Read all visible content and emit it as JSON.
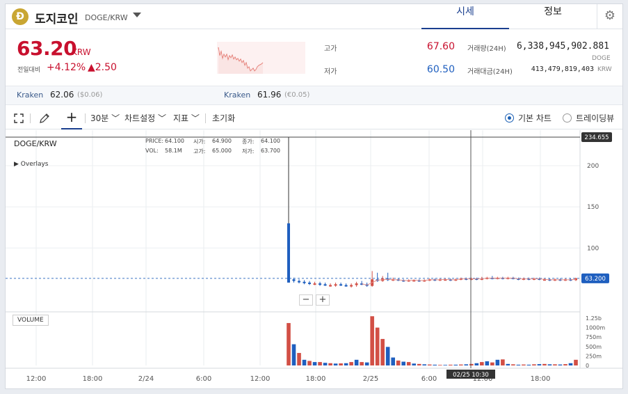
{
  "header": {
    "coin_logo_glyph": "Ð",
    "coin_name": "도지코인",
    "pair": "DOGE/KRW",
    "tabs": [
      {
        "label": "시세"
      },
      {
        "label": "정보"
      }
    ],
    "settings_icon": "gear-icon"
  },
  "price": {
    "current": "63.20",
    "unit": "KRW",
    "change_label": "전일대비",
    "change_pct": "+4.12%",
    "change_amt": "▲2.50"
  },
  "stats": {
    "high_label": "고가",
    "high_value": "67.60",
    "low_label": "저가",
    "low_value": "60.50",
    "volume_label": "거래량(24H)",
    "volume_value": "6,338,945,902.881",
    "volume_unit": "DOGE",
    "turnover_label": "거래대금(24H)",
    "turnover_value": "413,479,819,403",
    "turnover_unit": "KRW"
  },
  "exchanges": [
    {
      "name": "Kraken",
      "value": "62.06",
      "sub": "($0.06)"
    },
    {
      "name": "Kraken",
      "value": "61.96",
      "sub": "(€0.05)"
    }
  ],
  "toolbar": {
    "interval": "30분",
    "chart_settings": "차트설정",
    "indicators": "지표",
    "reset": "초기화",
    "basic_chart": "기본 차트",
    "tradingview": "트레이딩뷰"
  },
  "chart": {
    "symbol": "DOGE/KRW",
    "overlays": "Overlays",
    "ohlc": {
      "price_lbl": "PRICE:",
      "price": "64.100",
      "open_lbl": "시가:",
      "open": "64.900",
      "close_lbl": "종가:",
      "close": "64.100",
      "vol_lbl": "VOL:",
      "vol": "58.1M",
      "high_lbl": "고가:",
      "high": "65.000",
      "low_lbl": "저가:",
      "low": "63.700"
    },
    "max_label": "234.655",
    "current_label": "63.200",
    "volume_label": "VOLUME",
    "crosshair_time": "02/25 10:30",
    "price_ticks": [
      "200",
      "150",
      "100"
    ],
    "volume_ticks": [
      "1.25b",
      "1000m",
      "750m",
      "500m",
      "250m",
      "0"
    ],
    "time_ticks": [
      "12:00",
      "18:00",
      "2/24",
      "6:00",
      "12:00",
      "18:00",
      "2/25",
      "6:00",
      "12:00",
      "18:00"
    ],
    "colors": {
      "up": "#d24f45",
      "down": "#1f5fbf"
    }
  },
  "chart_data": {
    "type": "candlestick",
    "price_axis": [
      0,
      234.655
    ],
    "candles": [
      {
        "o": 58,
        "c": 130,
        "h": 234.655,
        "l": 58
      },
      {
        "o": 62,
        "c": 60,
        "h": 64,
        "l": 58
      },
      {
        "o": 60,
        "c": 59,
        "h": 62,
        "l": 57
      },
      {
        "o": 59,
        "c": 58,
        "h": 61,
        "l": 56
      },
      {
        "o": 58,
        "c": 57,
        "h": 60,
        "l": 55
      },
      {
        "o": 57,
        "c": 57,
        "h": 59,
        "l": 55
      },
      {
        "o": 57,
        "c": 56,
        "h": 59,
        "l": 54
      },
      {
        "o": 56,
        "c": 55,
        "h": 58,
        "l": 54
      },
      {
        "o": 55,
        "c": 55,
        "h": 57,
        "l": 53
      },
      {
        "o": 55,
        "c": 56,
        "h": 58,
        "l": 53
      },
      {
        "o": 56,
        "c": 55,
        "h": 58,
        "l": 54
      },
      {
        "o": 55,
        "c": 54,
        "h": 57,
        "l": 53
      },
      {
        "o": 54,
        "c": 55,
        "h": 57,
        "l": 52
      },
      {
        "o": 55,
        "c": 57,
        "h": 59,
        "l": 53
      },
      {
        "o": 57,
        "c": 56,
        "h": 60,
        "l": 55
      },
      {
        "o": 56,
        "c": 54,
        "h": 58,
        "l": 53
      },
      {
        "o": 54,
        "c": 62,
        "h": 72,
        "l": 53
      },
      {
        "o": 62,
        "c": 60,
        "h": 70,
        "l": 59
      },
      {
        "o": 60,
        "c": 63,
        "h": 66,
        "l": 59
      },
      {
        "o": 63,
        "c": 61,
        "h": 70,
        "l": 60
      },
      {
        "o": 61,
        "c": 62,
        "h": 64,
        "l": 60
      },
      {
        "o": 62,
        "c": 61,
        "h": 63,
        "l": 60
      },
      {
        "o": 61,
        "c": 60,
        "h": 62,
        "l": 59
      },
      {
        "o": 60,
        "c": 61,
        "h": 62,
        "l": 59
      },
      {
        "o": 61,
        "c": 61,
        "h": 62,
        "l": 60
      },
      {
        "o": 61,
        "c": 60,
        "h": 62,
        "l": 59
      },
      {
        "o": 60,
        "c": 61,
        "h": 62,
        "l": 59
      },
      {
        "o": 61,
        "c": 62,
        "h": 63,
        "l": 60
      },
      {
        "o": 62,
        "c": 61,
        "h": 63,
        "l": 60
      },
      {
        "o": 61,
        "c": 62,
        "h": 63,
        "l": 60
      },
      {
        "o": 62,
        "c": 62,
        "h": 63,
        "l": 61
      },
      {
        "o": 62,
        "c": 61,
        "h": 63,
        "l": 60
      },
      {
        "o": 61,
        "c": 62,
        "h": 63,
        "l": 60
      },
      {
        "o": 62,
        "c": 63,
        "h": 64,
        "l": 61
      },
      {
        "o": 63,
        "c": 62,
        "h": 64,
        "l": 61
      },
      {
        "o": 62,
        "c": 63,
        "h": 64,
        "l": 61
      },
      {
        "o": 63,
        "c": 62,
        "h": 64,
        "l": 61
      },
      {
        "o": 62,
        "c": 63,
        "h": 65,
        "l": 61
      },
      {
        "o": 63,
        "c": 64,
        "h": 65,
        "l": 62
      },
      {
        "o": 64,
        "c": 63,
        "h": 66,
        "l": 62
      },
      {
        "o": 63,
        "c": 64,
        "h": 65,
        "l": 62
      },
      {
        "o": 64,
        "c": 63,
        "h": 65,
        "l": 62
      },
      {
        "o": 63,
        "c": 64,
        "h": 65,
        "l": 62
      },
      {
        "o": 64,
        "c": 63,
        "h": 65,
        "l": 62
      },
      {
        "o": 63,
        "c": 62,
        "h": 64,
        "l": 61
      },
      {
        "o": 62,
        "c": 63,
        "h": 64,
        "l": 61
      },
      {
        "o": 63,
        "c": 62,
        "h": 64,
        "l": 61
      },
      {
        "o": 62,
        "c": 63,
        "h": 64,
        "l": 61
      },
      {
        "o": 63,
        "c": 62,
        "h": 64,
        "l": 61
      },
      {
        "o": 62,
        "c": 62,
        "h": 63,
        "l": 61
      },
      {
        "o": 62,
        "c": 61,
        "h": 63,
        "l": 60
      },
      {
        "o": 61,
        "c": 62,
        "h": 63,
        "l": 60
      },
      {
        "o": 62,
        "c": 61,
        "h": 63,
        "l": 60
      },
      {
        "o": 61,
        "c": 62,
        "h": 63,
        "l": 60
      },
      {
        "o": 62,
        "c": 61,
        "h": 63,
        "l": 60
      },
      {
        "o": 61,
        "c": 63.2,
        "h": 64,
        "l": 60
      }
    ],
    "volume_axis": [
      0,
      1250
    ],
    "volumes": [
      1120,
      560,
      330,
      150,
      120,
      90,
      90,
      70,
      60,
      50,
      55,
      60,
      90,
      150,
      90,
      80,
      1300,
      1000,
      700,
      490,
      210,
      130,
      100,
      90,
      50,
      40,
      30,
      25,
      20,
      15,
      15,
      20,
      20,
      25,
      30,
      40,
      60,
      90,
      110,
      80,
      150,
      160,
      40,
      30,
      20,
      25,
      20,
      30,
      35,
      40,
      30,
      30,
      25,
      35,
      60,
      150
    ],
    "volume_dir": [
      "up",
      "down",
      "up",
      "down",
      "up",
      "down",
      "up",
      "down",
      "up",
      "down",
      "up",
      "down",
      "up",
      "down",
      "up",
      "down",
      "up",
      "up",
      "up",
      "down",
      "down",
      "up",
      "down",
      "up",
      "down",
      "up",
      "down",
      "up",
      "down",
      "up",
      "down",
      "up",
      "down",
      "up",
      "down",
      "up",
      "down",
      "up",
      "down",
      "up",
      "down",
      "up",
      "down",
      "up",
      "down",
      "up",
      "down",
      "up",
      "down",
      "up",
      "down",
      "up",
      "down",
      "up",
      "down",
      "up"
    ]
  }
}
